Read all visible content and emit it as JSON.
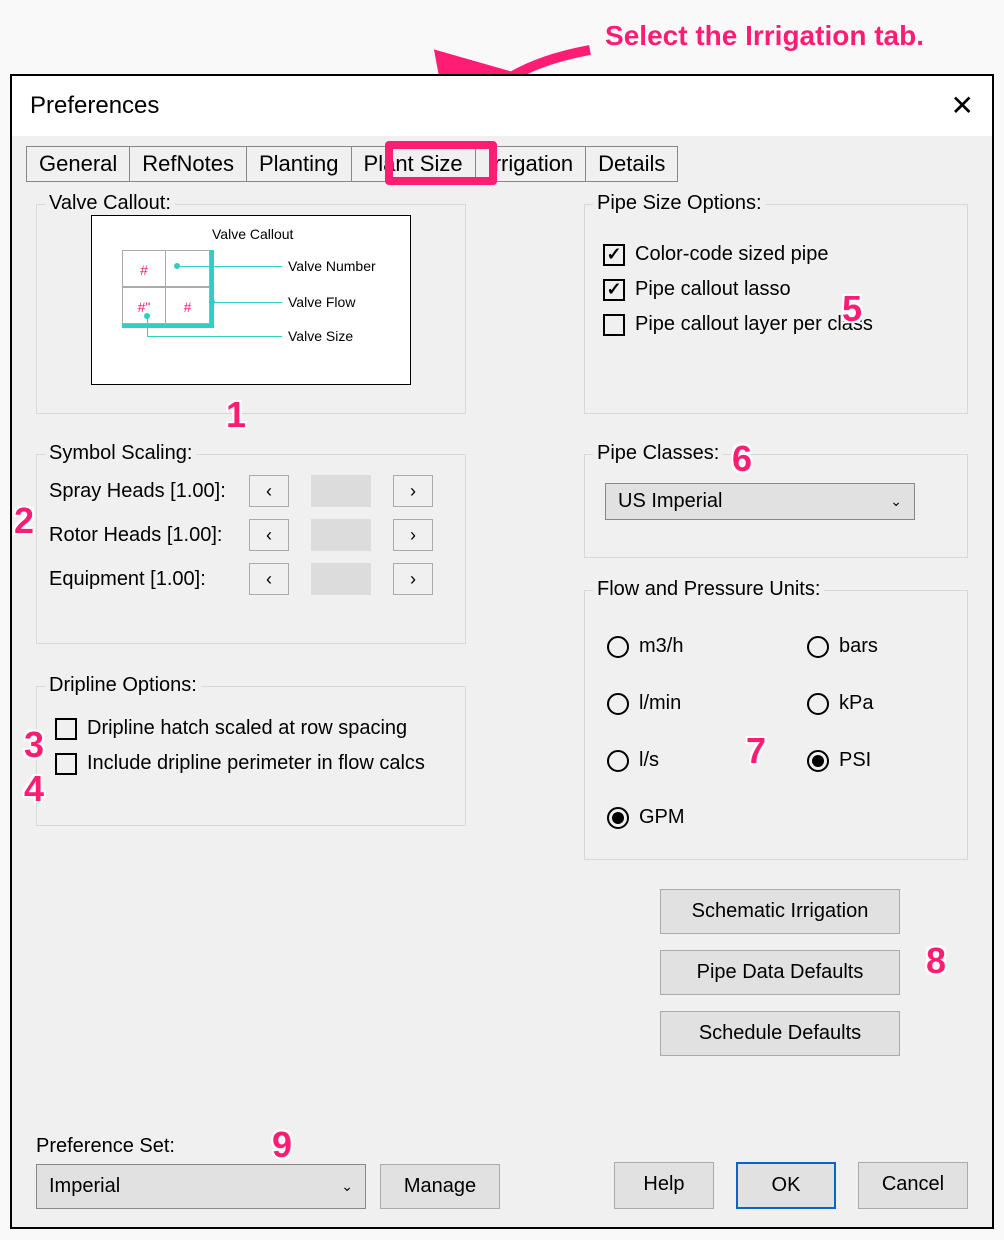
{
  "instruction": "Select the Irrigation tab.",
  "dialog_title": "Preferences",
  "tabs": [
    "General",
    "RefNotes",
    "Planting",
    "Plant Size",
    "Irrigation",
    "Details"
  ],
  "valve_callout": {
    "legend": "Valve Callout:",
    "title": "Valve Callout",
    "labels": [
      "Valve Number",
      "Valve Flow",
      "Valve Size"
    ]
  },
  "symbol_scaling": {
    "legend": "Symbol Scaling:",
    "rows": [
      "Spray Heads [1.00]:",
      "Rotor Heads [1.00]:",
      "Equipment [1.00]:"
    ]
  },
  "dripline": {
    "legend": "Dripline Options:",
    "opt1": "Dripline hatch scaled at row spacing",
    "opt2": "Include dripline perimeter in flow calcs"
  },
  "pipe_size": {
    "legend": "Pipe Size Options:",
    "opt1": "Color-code sized pipe",
    "opt2": "Pipe callout lasso",
    "opt3": "Pipe callout layer per class"
  },
  "pipe_classes": {
    "legend": "Pipe Classes:",
    "value": "US Imperial"
  },
  "flow_pressure": {
    "legend": "Flow and Pressure Units:",
    "flow": [
      "m3/h",
      "l/min",
      "l/s",
      "GPM"
    ],
    "pressure": [
      "bars",
      "kPa",
      "PSI"
    ]
  },
  "action_buttons": [
    "Schematic Irrigation",
    "Pipe Data Defaults",
    "Schedule Defaults"
  ],
  "pref_set": {
    "label": "Preference Set:",
    "value": "Imperial",
    "manage": "Manage"
  },
  "buttons": {
    "help": "Help",
    "ok": "OK",
    "cancel": "Cancel"
  }
}
